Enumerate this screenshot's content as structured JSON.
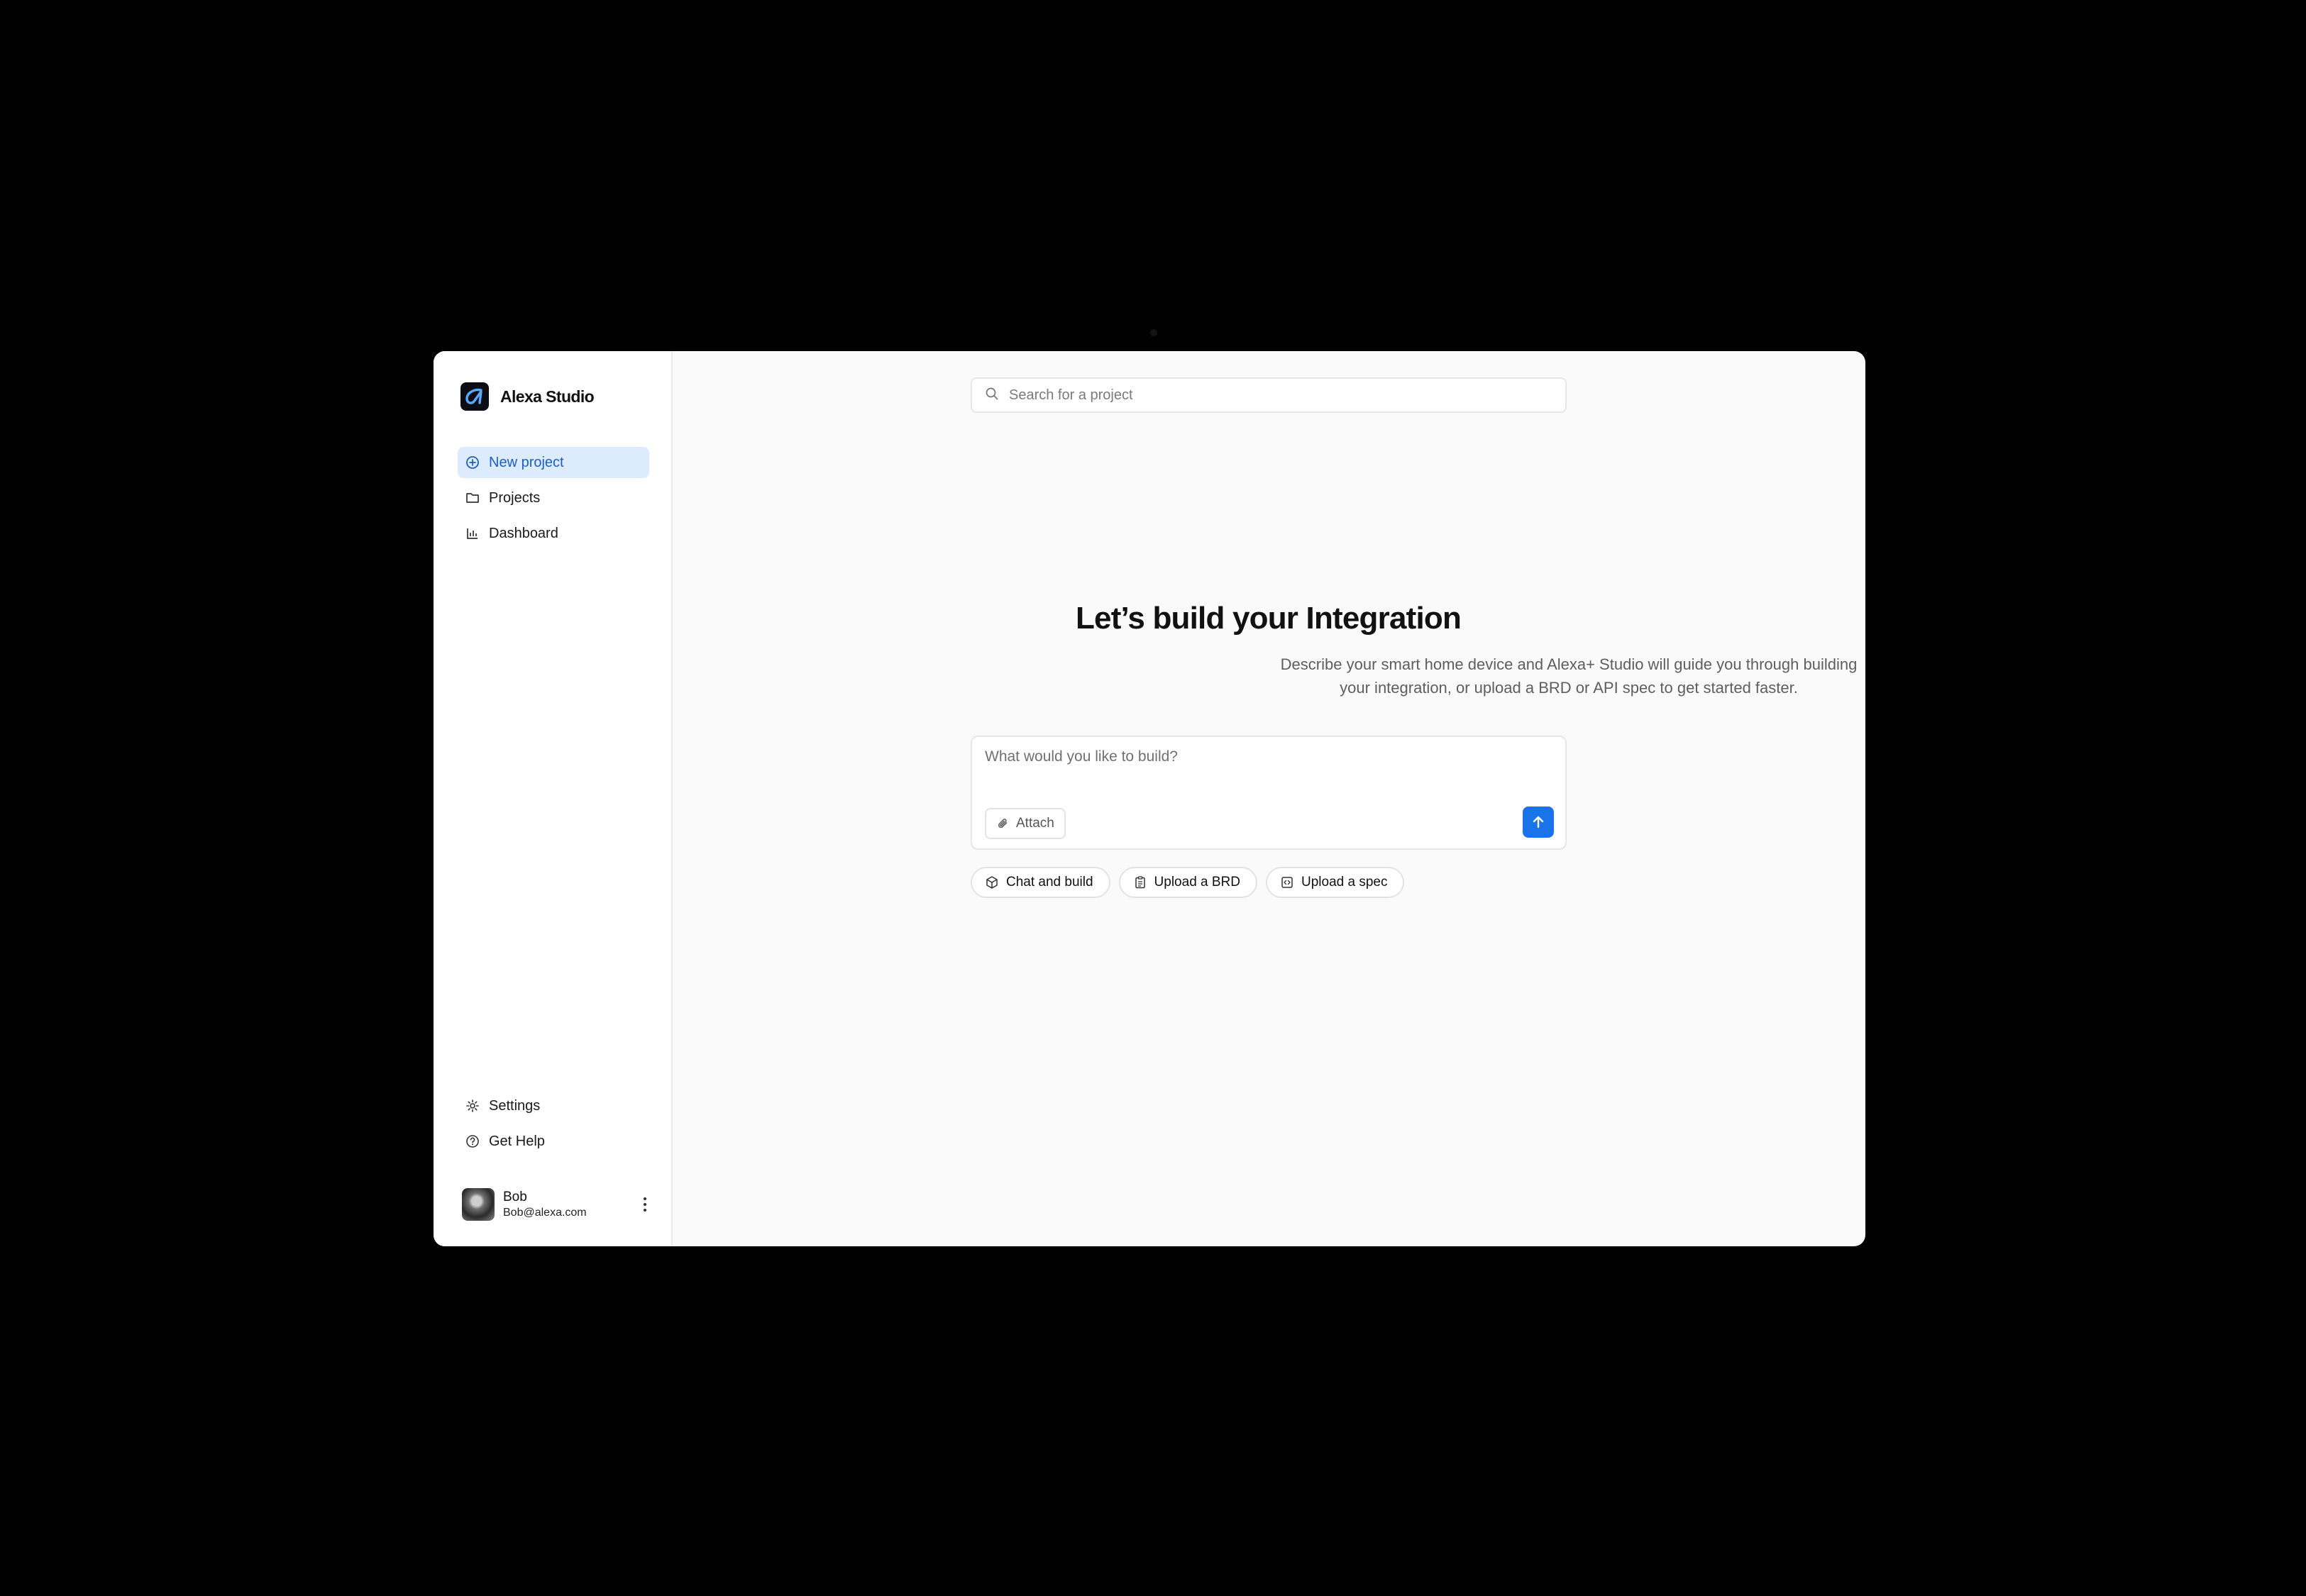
{
  "app": {
    "name": "Alexa Studio",
    "logo_icon": "alexa-logo-icon"
  },
  "sidebar": {
    "nav": [
      {
        "label": "New project",
        "icon": "plus-circle-icon",
        "active": true
      },
      {
        "label": "Projects",
        "icon": "folder-icon",
        "active": false
      },
      {
        "label": "Dashboard",
        "icon": "bar-chart-icon",
        "active": false
      }
    ],
    "bottom": [
      {
        "label": "Settings",
        "icon": "gear-icon"
      },
      {
        "label": "Get Help",
        "icon": "help-circle-icon"
      }
    ],
    "user": {
      "name": "Bob",
      "email": "Bob@alexa.com"
    }
  },
  "search": {
    "placeholder": "Search for a project",
    "value": ""
  },
  "hero": {
    "title": "Let’s build your Integration",
    "description": "Describe your smart home device and Alexa+ Studio will guide you through building your integration, or upload a BRD or API spec to get started faster."
  },
  "composer": {
    "placeholder": "What would you like to build?",
    "value": "",
    "attach_label": "Attach"
  },
  "quick_actions": [
    {
      "label": "Chat and build",
      "icon": "cube-icon"
    },
    {
      "label": "Upload a BRD",
      "icon": "clipboard-icon"
    },
    {
      "label": "Upload a spec",
      "icon": "code-file-icon"
    }
  ],
  "colors": {
    "accent": "#1a73e8",
    "active_nav_bg": "#dcebfd",
    "active_nav_text": "#1d5fbf",
    "frame_bg": "#000000"
  }
}
